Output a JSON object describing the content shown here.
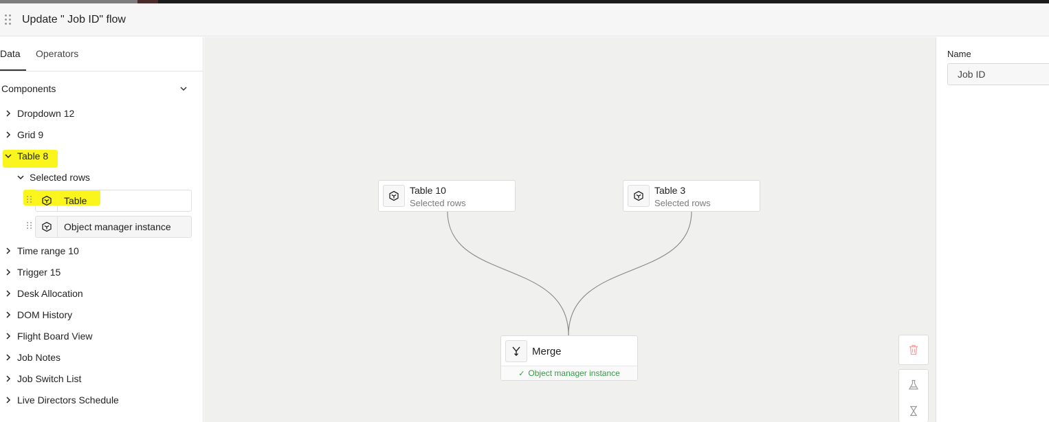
{
  "header": {
    "title": "Update \" Job ID\" flow"
  },
  "left_panel": {
    "tabs": [
      {
        "label": "Data",
        "active": true
      },
      {
        "label": "Operators",
        "active": false
      }
    ],
    "section_title": "Components",
    "tree": [
      {
        "label": "Dropdown 12",
        "expanded": false
      },
      {
        "label": "Grid 9",
        "expanded": false
      },
      {
        "label": "Table 8",
        "expanded": true,
        "highlighted": true
      },
      {
        "label": "Selected rows",
        "expanded": true
      },
      {
        "label": "Time range 10",
        "expanded": false
      },
      {
        "label": "Trigger 15",
        "expanded": false
      },
      {
        "label": "Desk Allocation",
        "expanded": false
      },
      {
        "label": "DOM History",
        "expanded": false
      },
      {
        "label": "Flight Board View",
        "expanded": false
      },
      {
        "label": "Job Notes",
        "expanded": false
      },
      {
        "label": "Job Switch List",
        "expanded": false
      },
      {
        "label": "Live Directors Schedule",
        "expanded": false
      }
    ],
    "selected_row_items": [
      {
        "label": "Table",
        "highlighted": true,
        "icon": "cube-icon"
      },
      {
        "label": "Object manager instance",
        "highlighted": false,
        "icon": "cube-icon"
      }
    ],
    "highlight_color": "#f9f51d"
  },
  "canvas": {
    "nodes": [
      {
        "id": "table10",
        "title": "Table 10",
        "subtitle": "Selected rows",
        "icon": "cube-icon"
      },
      {
        "id": "table3",
        "title": "Table 3",
        "subtitle": "Selected rows",
        "icon": "cube-icon"
      },
      {
        "id": "merge",
        "title": "Merge",
        "status": "Object manager instance",
        "icon": "merge-icon"
      }
    ],
    "status_color": "#2f9d41",
    "toolbar": [
      "trash-icon",
      "flask-icon",
      "hourglass-icon"
    ]
  },
  "right_panel": {
    "name_label": "Name",
    "name_value": "Job ID"
  }
}
